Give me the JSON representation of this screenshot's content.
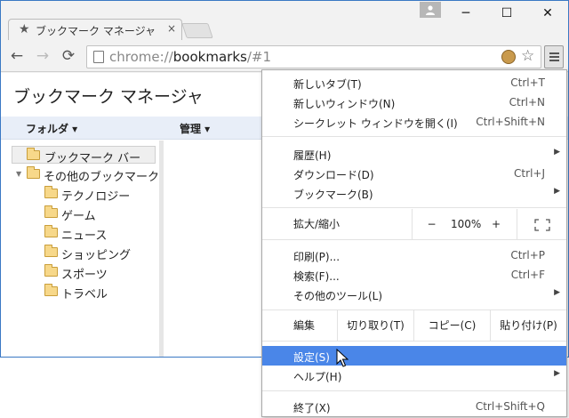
{
  "window": {
    "tab_title": "ブックマーク マネージャ",
    "tab_close": "×",
    "minimize": "─",
    "maximize": "☐",
    "close": "✕"
  },
  "toolbar": {
    "back": "←",
    "forward": "→",
    "reload": "⟳",
    "url_prefix": "chrome://",
    "url_host": "bookmarks",
    "url_path": "/#1",
    "bookmark_star": "☆"
  },
  "manager": {
    "title": "ブックマーク マネージャ",
    "folders_header": "フォルダ ▾",
    "organize_header": "管理 ▾",
    "tree": [
      {
        "label": "ブックマーク バー",
        "selected": true
      },
      {
        "label": "その他のブックマーク"
      },
      {
        "label": "テクノロジー"
      },
      {
        "label": "ゲーム"
      },
      {
        "label": "ニュース"
      },
      {
        "label": "ショッピング"
      },
      {
        "label": "スポーツ"
      },
      {
        "label": "トラベル"
      }
    ]
  },
  "menu": {
    "new_tab": {
      "label": "新しいタブ(T)",
      "shortcut": "Ctrl+T"
    },
    "new_window": {
      "label": "新しいウィンドウ(N)",
      "shortcut": "Ctrl+N"
    },
    "incognito": {
      "label": "シークレット ウィンドウを開く(I)",
      "shortcut": "Ctrl+Shift+N"
    },
    "history": {
      "label": "履歴(H)"
    },
    "downloads": {
      "label": "ダウンロード(D)",
      "shortcut": "Ctrl+J"
    },
    "bookmarks": {
      "label": "ブックマーク(B)"
    },
    "zoom": {
      "label": "拡大/縮小",
      "minus": "−",
      "value": "100%",
      "plus": "+"
    },
    "print": {
      "label": "印刷(P)...",
      "shortcut": "Ctrl+P"
    },
    "find": {
      "label": "検索(F)...",
      "shortcut": "Ctrl+F"
    },
    "more_tools": {
      "label": "その他のツール(L)"
    },
    "edit": {
      "label": "編集",
      "cut": "切り取り(T)",
      "copy": "コピー(C)",
      "paste": "貼り付け(P)"
    },
    "settings": {
      "label": "設定(S)",
      "highlighted": true
    },
    "help": {
      "label": "ヘルプ(H)"
    },
    "exit": {
      "label": "終了(X)",
      "shortcut": "Ctrl+Shift+Q"
    },
    "submenu_arrow": "▶"
  },
  "colors": {
    "highlight": "#4a86e8",
    "window_border": "#3a78c4",
    "column_header_bg": "#e8eef8",
    "folder": "#f7d88a"
  }
}
